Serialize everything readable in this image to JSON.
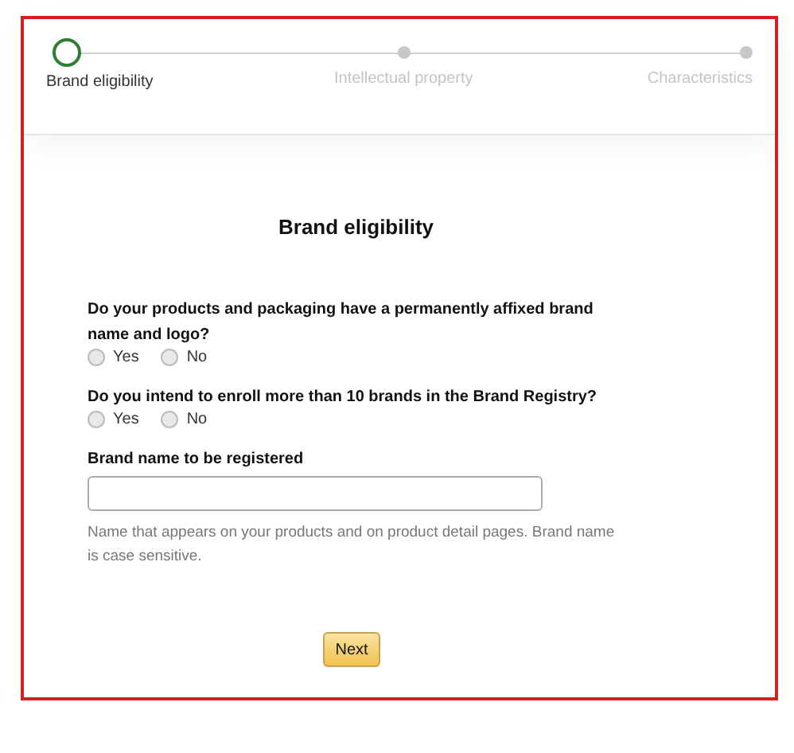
{
  "steps": [
    {
      "label": "Brand eligibility",
      "selected": true
    },
    {
      "label": "Intellectual property",
      "selected": false
    },
    {
      "label": "Characteristics",
      "selected": false
    }
  ],
  "title": "Brand eligibility",
  "questions": [
    {
      "text": "Do your products and packaging have a permanently affixed brand name and logo?",
      "options": [
        {
          "label": "Yes",
          "checked": false
        },
        {
          "label": "No",
          "checked": false
        }
      ]
    },
    {
      "text": "Do you intend to enroll more than 10 brands in the Brand Registry?",
      "options": [
        {
          "label": "Yes",
          "checked": false
        },
        {
          "label": "No",
          "checked": false
        }
      ]
    }
  ],
  "brand_field": {
    "label": "Brand name to be registered",
    "help": "Name that appears on your products and on product detail pages. Brand name is case sensitive."
  },
  "next_button": "Next"
}
